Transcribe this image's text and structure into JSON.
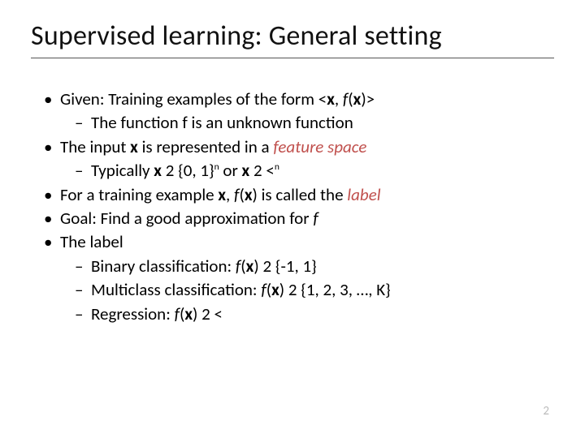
{
  "title": "Supervised learning: General setting",
  "bullets": [
    {
      "parts": [
        {
          "t": "Given: Training examples of the form <"
        },
        {
          "t": "x",
          "b": true
        },
        {
          "t": ", "
        },
        {
          "t": "f",
          "i": true
        },
        {
          "t": "("
        },
        {
          "t": "x",
          "b": true
        },
        {
          "t": ")>"
        }
      ],
      "sub": [
        {
          "parts": [
            {
              "t": "The function f is an unknown function"
            }
          ]
        }
      ]
    },
    {
      "parts": [
        {
          "t": "The input "
        },
        {
          "t": "x",
          "b": true
        },
        {
          "t": " is represented in a "
        },
        {
          "t": "feature space",
          "accent": true
        }
      ],
      "sub": [
        {
          "parts": [
            {
              "t": "Typically "
            },
            {
              "t": "x",
              "b": true
            },
            {
              "t": " 2 {0, 1}"
            },
            {
              "t": "n",
              "sup": true
            },
            {
              "t": " or "
            },
            {
              "t": "x",
              "b": true
            },
            {
              "t": " 2 <"
            },
            {
              "t": "n",
              "sup": true
            }
          ]
        }
      ]
    },
    {
      "parts": [
        {
          "t": "For a training example "
        },
        {
          "t": "x",
          "b": true
        },
        {
          "t": ", "
        },
        {
          "t": "f",
          "i": true
        },
        {
          "t": "("
        },
        {
          "t": "x",
          "b": true
        },
        {
          "t": ") is called the "
        },
        {
          "t": "label",
          "accent": true
        }
      ]
    },
    {
      "parts": [
        {
          "t": "Goal: Find a good approximation for "
        },
        {
          "t": "f",
          "i": true
        }
      ]
    },
    {
      "parts": [
        {
          "t": "The label"
        }
      ],
      "sub": [
        {
          "parts": [
            {
              "t": "Binary classification: "
            },
            {
              "t": "f",
              "i": true
            },
            {
              "t": "("
            },
            {
              "t": "x",
              "b": true
            },
            {
              "t": ") 2 {-1, 1}"
            }
          ]
        },
        {
          "parts": [
            {
              "t": "Multiclass classification: "
            },
            {
              "t": "f",
              "i": true
            },
            {
              "t": "("
            },
            {
              "t": "x",
              "b": true
            },
            {
              "t": ") 2 {1, 2, 3, …, K}"
            }
          ]
        },
        {
          "parts": [
            {
              "t": "Regression: "
            },
            {
              "t": "f",
              "i": true
            },
            {
              "t": "("
            },
            {
              "t": "x",
              "b": true
            },
            {
              "t": ") 2 <"
            }
          ]
        }
      ]
    }
  ],
  "page_number": "2"
}
